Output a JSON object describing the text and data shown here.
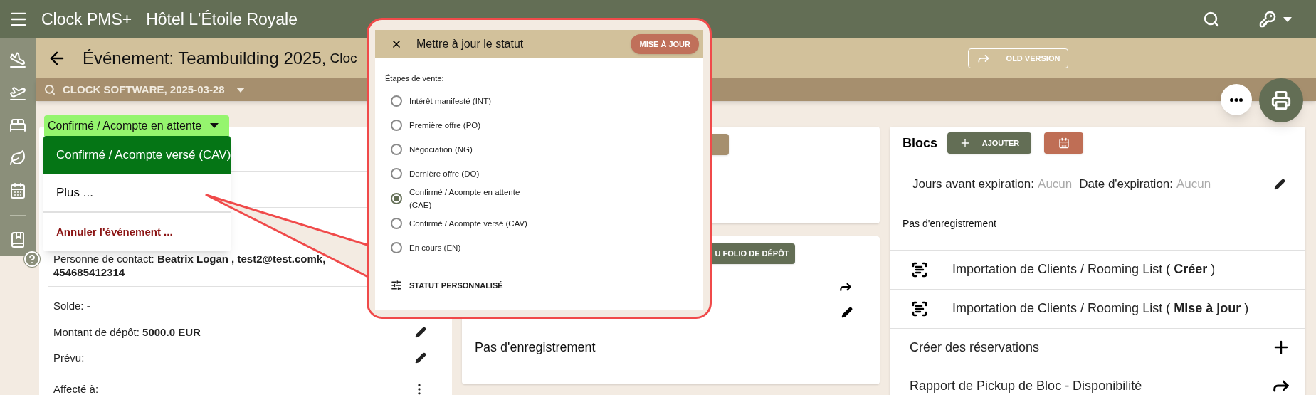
{
  "app_bar": {
    "brand": "Clock PMS+",
    "hotel": "Hôtel L'Étoile Royale"
  },
  "header": {
    "title": "Événement: Teambuilding 2025,",
    "subtitle": "Cloc",
    "old_version": "OLD VERSION"
  },
  "subbar": {
    "label": "CLOCK SOFTWARE, 2025-03-28"
  },
  "status_chip": {
    "label": "Confirmé / Acompte en attente"
  },
  "status_menu": [
    {
      "label": "Confirmé / Acompte versé (CAV)",
      "kind": "primary"
    },
    {
      "label": "Plus ...",
      "kind": "plain"
    },
    {
      "label": "Annuler l'événement ...",
      "kind": "danger"
    }
  ],
  "details": {
    "contact": "Personne de contact: **Beatrix Logan , test2@test.comk, 454685412314**",
    "balance": "Solde: **-**",
    "deposit": "Montant de dépôt: **5000.0 EUR**",
    "planned": "Prévu:",
    "assigned": "Affecté à:"
  },
  "deposit_card": {
    "action": "U FOLIO DE DÉPÔT",
    "empty": "Pas d'enregistrement"
  },
  "blocks": {
    "title": "Blocs",
    "add": "AJOUTER",
    "expiry_days_label": "Jours avant expiration:",
    "expiry_days": "Aucun",
    "expiry_date_label": "Date d'expiration:",
    "expiry_date": "Aucun",
    "empty": "Pas d'enregistrement",
    "rows": [
      {
        "label": "Importation de Clients / Rooming List ( **Créer** )",
        "kind": "import"
      },
      {
        "label": "Importation de Clients / Rooming List ( **Mise à jour** )",
        "kind": "import"
      },
      {
        "label": "Créer des réservations",
        "kind": "add"
      },
      {
        "label": "Rapport de Pickup de Bloc - Disponibilité",
        "kind": "report"
      }
    ]
  },
  "dialog": {
    "title": "Mettre à jour le statut",
    "action": "MISE À JOUR",
    "section": "Étapes de vente:",
    "options": [
      {
        "label": "Intérêt manifesté (INT)",
        "selected": false
      },
      {
        "label": "Première offre (PO)",
        "selected": false
      },
      {
        "label": "Négociation (NG)",
        "selected": false
      },
      {
        "label": "Dernière offre (DO)",
        "selected": false
      },
      {
        "label": "Confirmé / Acompte en attente (CAE)",
        "selected": true
      },
      {
        "label": "Confirmé / Acompte versé (CAV)",
        "selected": false
      },
      {
        "label": "En cours (EN)",
        "selected": false
      }
    ],
    "custom": "STATUT PERSONNALISÉ"
  }
}
